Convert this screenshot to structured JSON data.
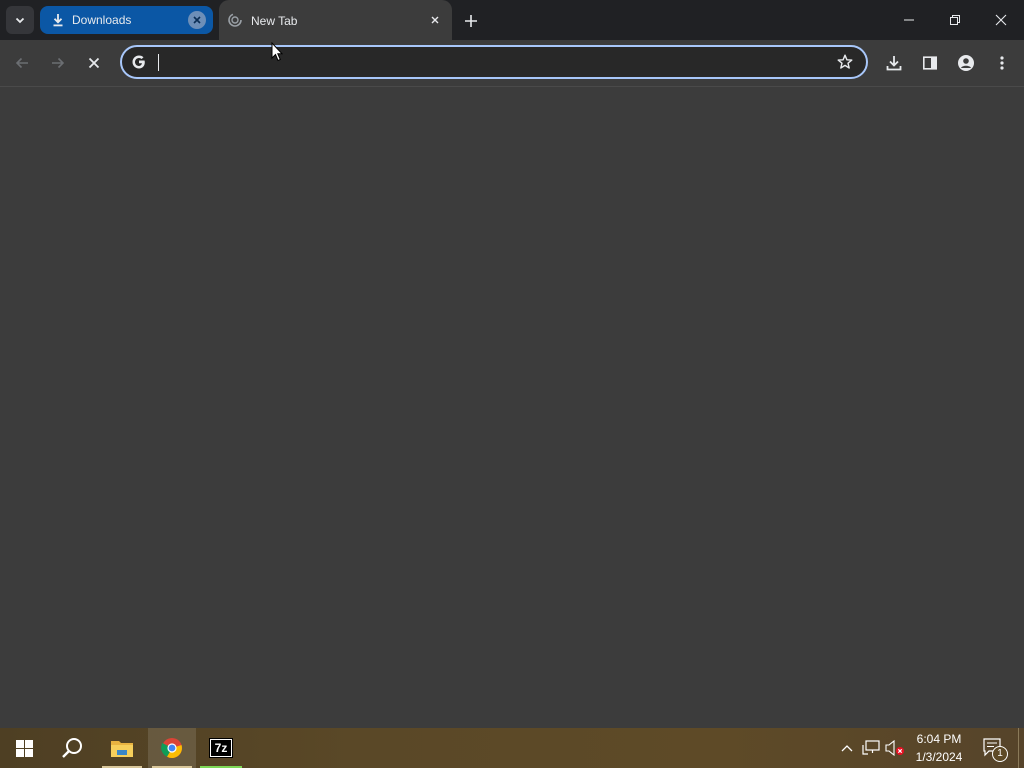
{
  "browser": {
    "tabs": [
      {
        "title": "Downloads",
        "icon": "download-icon",
        "active": false,
        "color": "#0b57a5"
      },
      {
        "title": "New Tab",
        "icon": "loading-spinner-icon",
        "active": true
      }
    ],
    "omnibox": {
      "value": "",
      "placeholder": "",
      "icon": "google-g-icon"
    },
    "toolbar_icons": [
      "back-arrow-icon",
      "forward-arrow-icon",
      "stop-loading-icon",
      "bookmark-star-icon",
      "download-icon",
      "side-panel-icon",
      "profile-icon",
      "more-menu-icon"
    ]
  },
  "taskbar": {
    "apps": [
      "start-windows-icon",
      "search-icon",
      "file-explorer-icon",
      "chrome-icon",
      "7zip-icon"
    ],
    "seven_zip_label": "7z",
    "clock": {
      "time": "6:04 PM",
      "date": "1/3/2024"
    },
    "notifications_count": "1"
  }
}
